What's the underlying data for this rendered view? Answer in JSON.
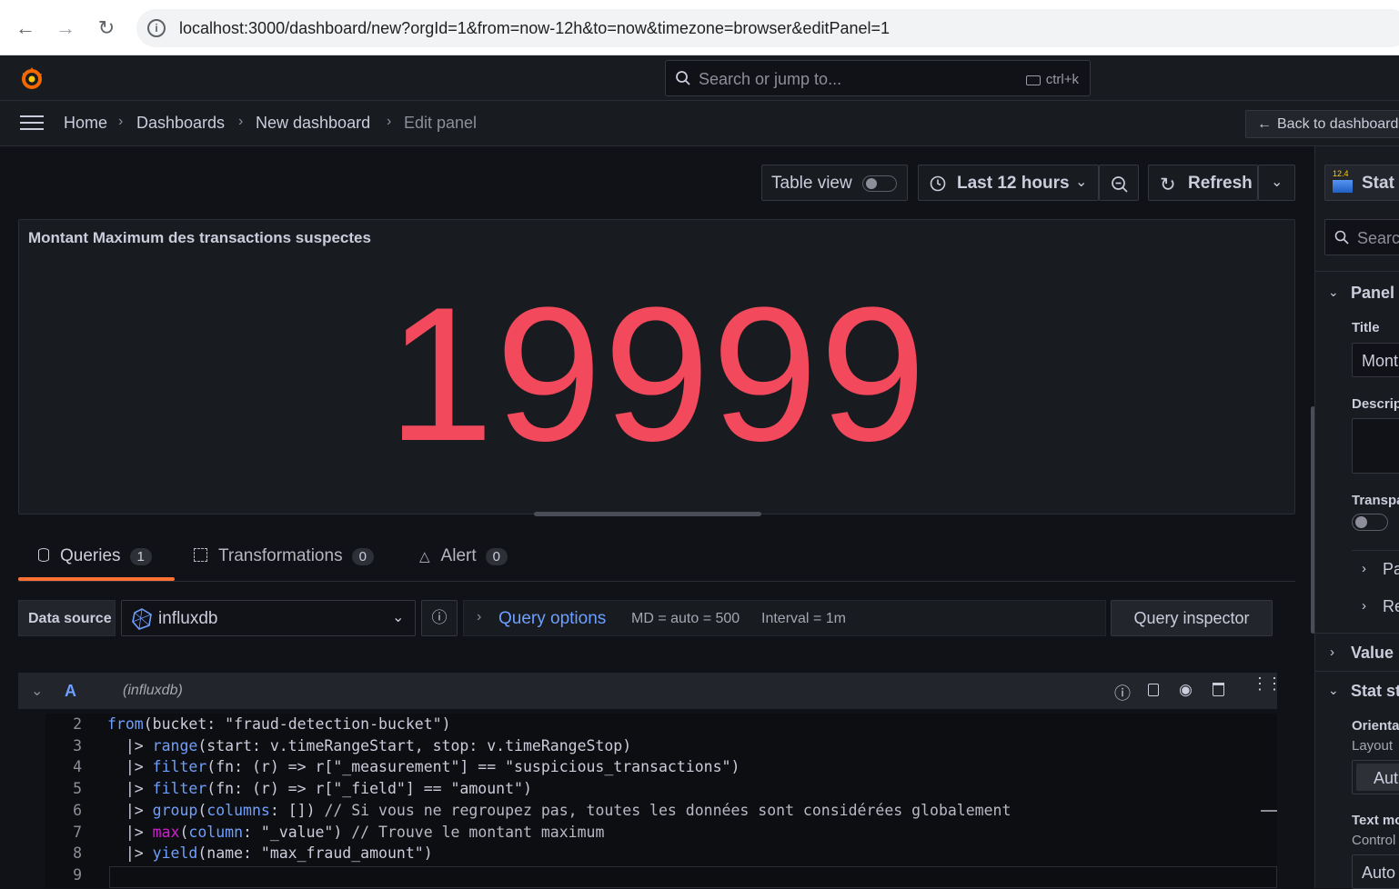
{
  "browser": {
    "url": "localhost:3000/dashboard/new?orgId=1&from=now-12h&to=now&timezone=browser&editPanel=1"
  },
  "topnav": {
    "search_placeholder": "Search or jump to...",
    "search_shortcut": "ctrl+k"
  },
  "breadcrumb": {
    "items": [
      "Home",
      "Dashboards",
      "New dashboard",
      "Edit panel"
    ],
    "back_label": "Back to dashboard"
  },
  "toolbar": {
    "table_view_label": "Table view",
    "table_view_on": false,
    "time_range": "Last 12 hours",
    "refresh_label": "Refresh"
  },
  "panel": {
    "title": "Montant Maximum des transactions suspectes",
    "value": "19999",
    "value_color": "#f2495c"
  },
  "tabs": [
    {
      "label": "Queries",
      "count": "1",
      "active": true
    },
    {
      "label": "Transformations",
      "count": "0",
      "active": false
    },
    {
      "label": "Alert",
      "count": "0",
      "active": false
    }
  ],
  "datasource": {
    "label": "Data source",
    "selected": "influxdb",
    "query_options_label": "Query options",
    "md": "MD = auto = 500",
    "interval": "Interval = 1m",
    "inspector_label": "Query inspector"
  },
  "query": {
    "ref_id": "A",
    "ds_name": "(influxdb)",
    "lines": [
      {
        "num": "2",
        "text": "from(bucket: \"fraud-detection-bucket\")"
      },
      {
        "num": "3",
        "text": "  |> range(start: v.timeRangeStart, stop: v.timeRangeStop)"
      },
      {
        "num": "4",
        "text": "  |> filter(fn: (r) => r[\"_measurement\"] == \"suspicious_transactions\")"
      },
      {
        "num": "5",
        "text": "  |> filter(fn: (r) => r[\"_field\"] == \"amount\")"
      },
      {
        "num": "6",
        "text": "  |> group(columns: []) // Si vous ne regroupez pas, toutes les données sont considérées globalement"
      },
      {
        "num": "7",
        "text": "  |> max(column: \"_value\") // Trouve le montant maximum"
      },
      {
        "num": "8",
        "text": "  |> yield(name: \"max_fraud_amount\")"
      },
      {
        "num": "9",
        "text": ""
      }
    ]
  },
  "sidebar": {
    "viz_version": "12.4",
    "viz_label": "Stat",
    "search_placeholder": "Searc",
    "panel_section": "Panel",
    "title_label": "Title",
    "title_value": "Mont",
    "description_label": "Descrip",
    "transparent_label": "Transpa",
    "sub_pa": "Pa",
    "sub_re": "Re",
    "value_section": "Value",
    "stat_section": "Stat st",
    "orientation_label": "Orienta",
    "layout_label": "Layout",
    "orientation_value": "Aut",
    "text_mode_label": "Text mo",
    "control_label": "Control",
    "text_mode_value": "Auto"
  }
}
